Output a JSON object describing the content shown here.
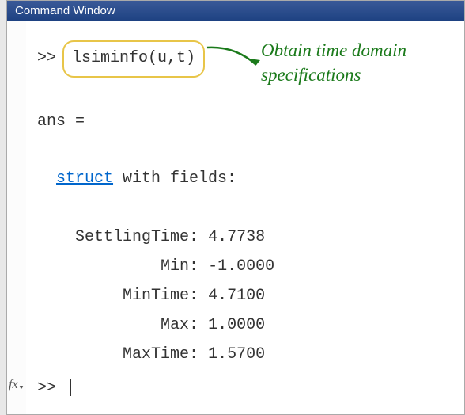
{
  "window": {
    "title": "Command Window"
  },
  "code": {
    "prompt": ">>",
    "command": "lsiminfo(u,t)",
    "ans_label": "ans =",
    "struct_keyword": "struct",
    "struct_text": " with fields:",
    "fields": [
      {
        "name": "SettlingTime",
        "value": "4.7738"
      },
      {
        "name": "Min",
        "value": "-1.0000"
      },
      {
        "name": "MinTime",
        "value": "4.7100"
      },
      {
        "name": "Max",
        "value": "1.0000"
      },
      {
        "name": "MaxTime",
        "value": "1.5700"
      }
    ]
  },
  "fx_label": "fx",
  "annotation": {
    "line1": "Obtain time domain",
    "line2": "specifications"
  }
}
